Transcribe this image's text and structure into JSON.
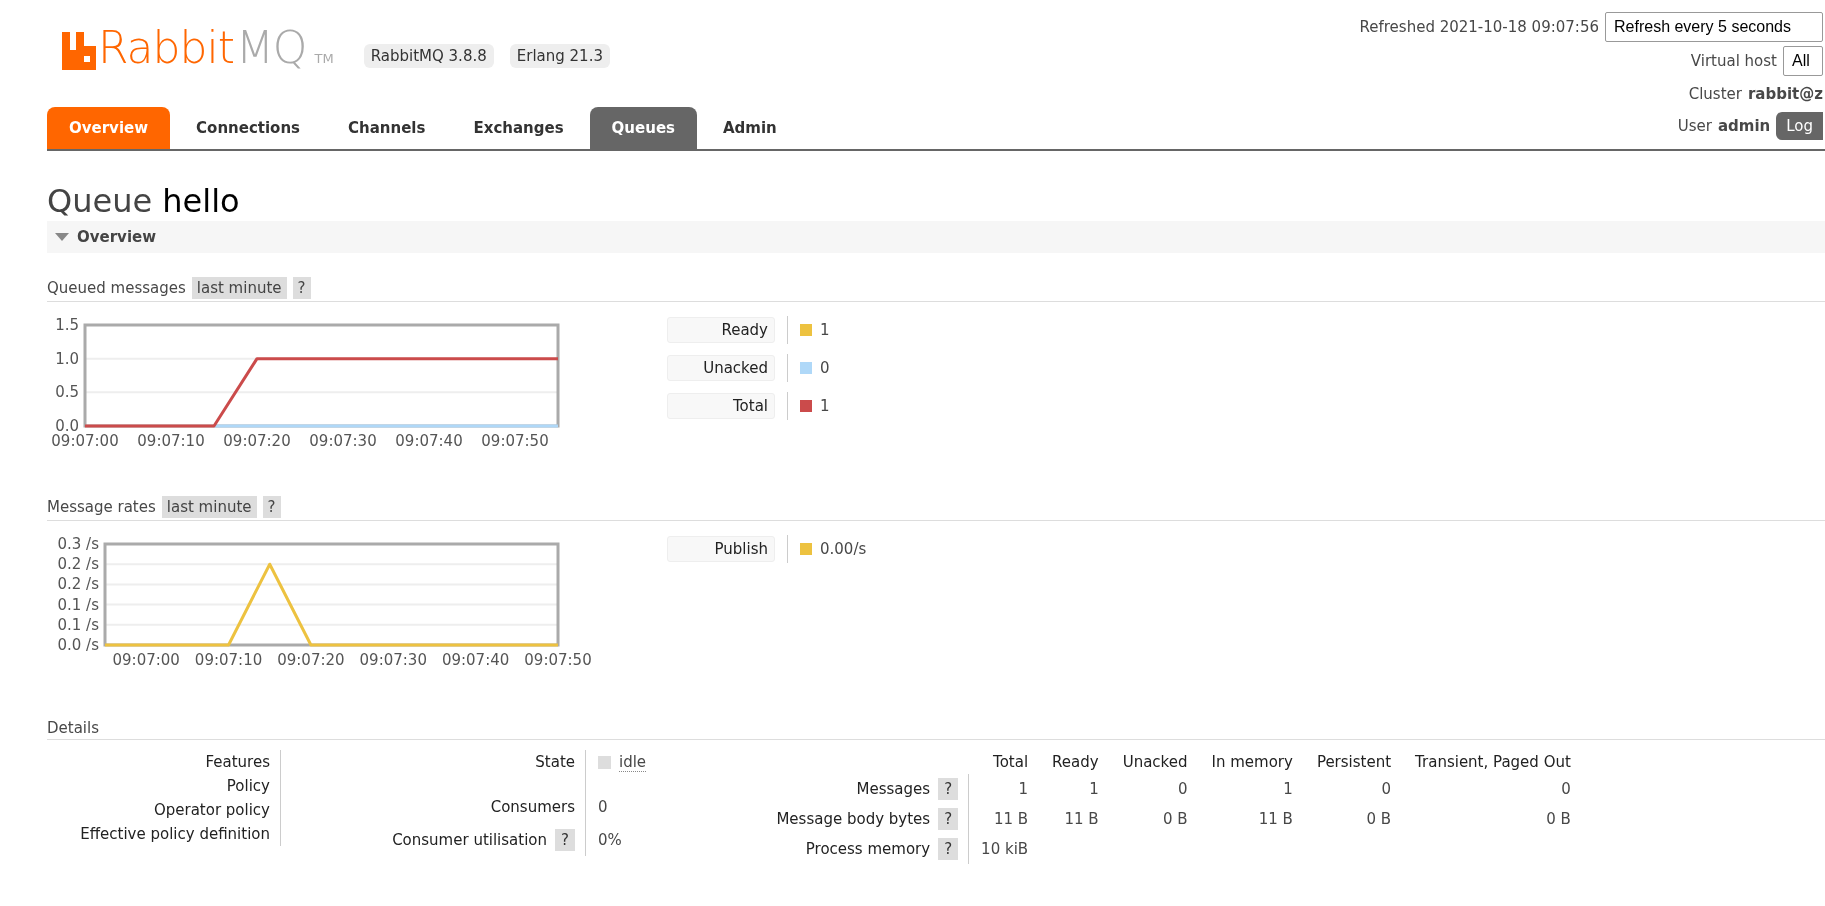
{
  "header": {
    "logo": {
      "primary": "Rabbit",
      "secondary": "MQ",
      "trademark": "TM"
    },
    "versions": [
      "RabbitMQ 3.8.8",
      "Erlang 21.3"
    ],
    "refreshed": "Refreshed 2021-10-18 09:07:56",
    "refresh_select": "Refresh every 5 seconds",
    "virtual_host": {
      "label": "Virtual host",
      "value": "All"
    },
    "cluster": {
      "label": "Cluster",
      "value": "rabbit@z"
    },
    "user": {
      "label": "User",
      "value": "admin",
      "logout": "Log"
    }
  },
  "tabs": [
    {
      "label": "Overview",
      "kind": "brand",
      "selected": false
    },
    {
      "label": "Connections",
      "kind": "plain",
      "selected": false
    },
    {
      "label": "Channels",
      "kind": "plain",
      "selected": false
    },
    {
      "label": "Exchanges",
      "kind": "plain",
      "selected": false
    },
    {
      "label": "Queues",
      "kind": "plain",
      "selected": true
    },
    {
      "label": "Admin",
      "kind": "plain",
      "selected": false
    }
  ],
  "title": {
    "prefix": "Queue",
    "name": "hello"
  },
  "section": {
    "title": "Overview",
    "expanded": true
  },
  "queued": {
    "title": "Queued messages",
    "range": "last minute",
    "help": "?",
    "legend_values": [
      "1",
      "0",
      "1"
    ],
    "chart_data": {
      "type": "line",
      "grid": true,
      "categories": [
        "09:07:00",
        null,
        "09:07:10",
        null,
        "09:07:20",
        null,
        "09:07:30",
        null,
        "09:07:40",
        null,
        "09:07:50",
        null
      ],
      "ylim": [
        0,
        1.5
      ],
      "yticks": [
        {
          "value": 0,
          "label": "0.0"
        },
        {
          "value": 0.5,
          "label": "0.5"
        },
        {
          "value": 1,
          "label": "1.0"
        },
        {
          "value": 1.5,
          "label": "1.5"
        }
      ],
      "series": [
        {
          "name": "Ready",
          "color": "#edc240",
          "values": [
            null,
            null,
            null,
            null,
            null,
            null,
            null,
            null,
            null,
            null,
            null,
            null
          ]
        },
        {
          "name": "Unacked",
          "color": "#afd8f8",
          "values": [
            null,
            null,
            null,
            0,
            0,
            0,
            0,
            0,
            0,
            0,
            0,
            0
          ]
        },
        {
          "name": "Total",
          "color": "#cb4b4b",
          "values": [
            0,
            0,
            0,
            0,
            1,
            1,
            1,
            1,
            1,
            1,
            1,
            1
          ]
        }
      ]
    }
  },
  "rates": {
    "title": "Message rates",
    "range": "last minute",
    "help": "?",
    "legend_values": [
      "0.00/s"
    ],
    "chart_data": {
      "type": "line",
      "grid": true,
      "categories": [
        null,
        "09:07:00",
        null,
        "09:07:10",
        null,
        "09:07:20",
        null,
        "09:07:30",
        null,
        "09:07:40",
        null,
        "09:07:50"
      ],
      "ylim": [
        0,
        0.25
      ],
      "yticks": [
        {
          "value": 0,
          "label": "0.0 /s"
        },
        {
          "value": 0.05,
          "label": "0.1 /s"
        },
        {
          "value": 0.1,
          "label": "0.1 /s"
        },
        {
          "value": 0.15,
          "label": "0.2 /s"
        },
        {
          "value": 0.2,
          "label": "0.2 /s"
        },
        {
          "value": 0.25,
          "label": "0.3 /s"
        }
      ],
      "series": [
        {
          "name": "Publish",
          "color": "#edc240",
          "values": [
            0,
            0,
            0,
            0,
            0.2,
            0,
            0,
            0,
            0,
            0,
            0,
            0
          ]
        }
      ]
    }
  },
  "details": {
    "title": "Details",
    "properties": [
      "Features",
      "Policy",
      "Operator policy",
      "Effective policy definition"
    ],
    "status": [
      {
        "label": "State",
        "kind": "state",
        "value": "idle"
      },
      {
        "label": "Consumers",
        "kind": "plain",
        "value": "0"
      },
      {
        "label": "Consumer utilisation",
        "kind": "plain",
        "help": "?",
        "value": "0%"
      }
    ],
    "messages": {
      "columns": [
        "Total",
        "Ready",
        "Unacked",
        "In memory",
        "Persistent",
        "Transient, Paged Out"
      ],
      "rows": [
        {
          "label": "Messages",
          "help": "?",
          "cells": [
            "1",
            "1",
            "0",
            "1",
            "0",
            "0"
          ]
        },
        {
          "label": "Message body bytes",
          "help": "?",
          "cells": [
            "11 B",
            "11 B",
            "0 B",
            "11 B",
            "0 B",
            "0 B"
          ]
        },
        {
          "label": "Process memory",
          "help": "?",
          "cells": [
            "10 kiB"
          ]
        }
      ]
    }
  }
}
